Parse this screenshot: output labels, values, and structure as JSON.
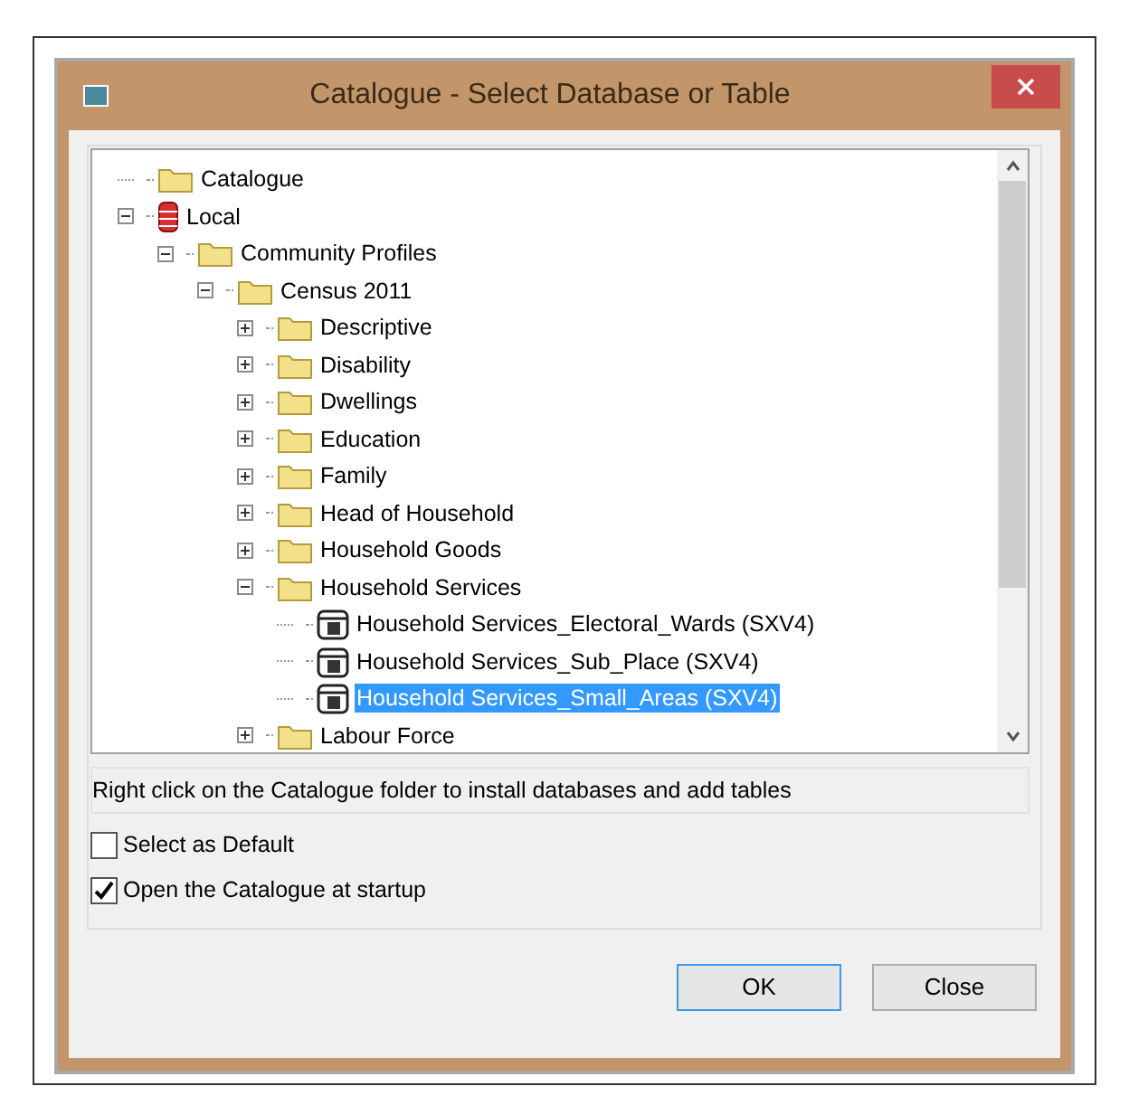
{
  "window": {
    "title": "Catalogue - Select Database or Table"
  },
  "tree": [
    {
      "label": "Catalogue",
      "kind": "folder",
      "selected": false
    },
    {
      "label": "Local",
      "kind": "database",
      "expanded": true,
      "selected": false,
      "children": [
        {
          "label": "Community Profiles",
          "kind": "folder",
          "expanded": true,
          "selected": false,
          "children": [
            {
              "label": "Census 2011",
              "kind": "folder",
              "expanded": true,
              "selected": false,
              "children": [
                {
                  "label": "Descriptive",
                  "kind": "folder",
                  "expanded": false,
                  "selected": false
                },
                {
                  "label": "Disability",
                  "kind": "folder",
                  "expanded": false,
                  "selected": false
                },
                {
                  "label": "Dwellings",
                  "kind": "folder",
                  "expanded": false,
                  "selected": false
                },
                {
                  "label": "Education",
                  "kind": "folder",
                  "expanded": false,
                  "selected": false
                },
                {
                  "label": "Family",
                  "kind": "folder",
                  "expanded": false,
                  "selected": false
                },
                {
                  "label": "Head of Household",
                  "kind": "folder",
                  "expanded": false,
                  "selected": false
                },
                {
                  "label": "Household Goods",
                  "kind": "folder",
                  "expanded": false,
                  "selected": false
                },
                {
                  "label": "Household Services",
                  "kind": "folder",
                  "expanded": true,
                  "selected": false,
                  "children": [
                    {
                      "label": "Household Services_Electoral_Wards (SXV4)",
                      "kind": "table",
                      "selected": false
                    },
                    {
                      "label": "Household Services_Sub_Place (SXV4)",
                      "kind": "table",
                      "selected": false
                    },
                    {
                      "label": "Household Services_Small_Areas (SXV4)",
                      "kind": "table",
                      "selected": true
                    }
                  ]
                },
                {
                  "label": "Labour Force",
                  "kind": "folder",
                  "expanded": false,
                  "selected": false
                }
              ]
            }
          ]
        }
      ]
    }
  ],
  "status_text": "Right click on the Catalogue folder to install databases and add tables",
  "options": [
    {
      "label": "Select as Default",
      "checked": false
    },
    {
      "label": "Open the Catalogue at startup",
      "checked": true
    }
  ],
  "buttons": [
    {
      "label": "OK",
      "default": true
    },
    {
      "label": "Close",
      "default": false
    }
  ]
}
